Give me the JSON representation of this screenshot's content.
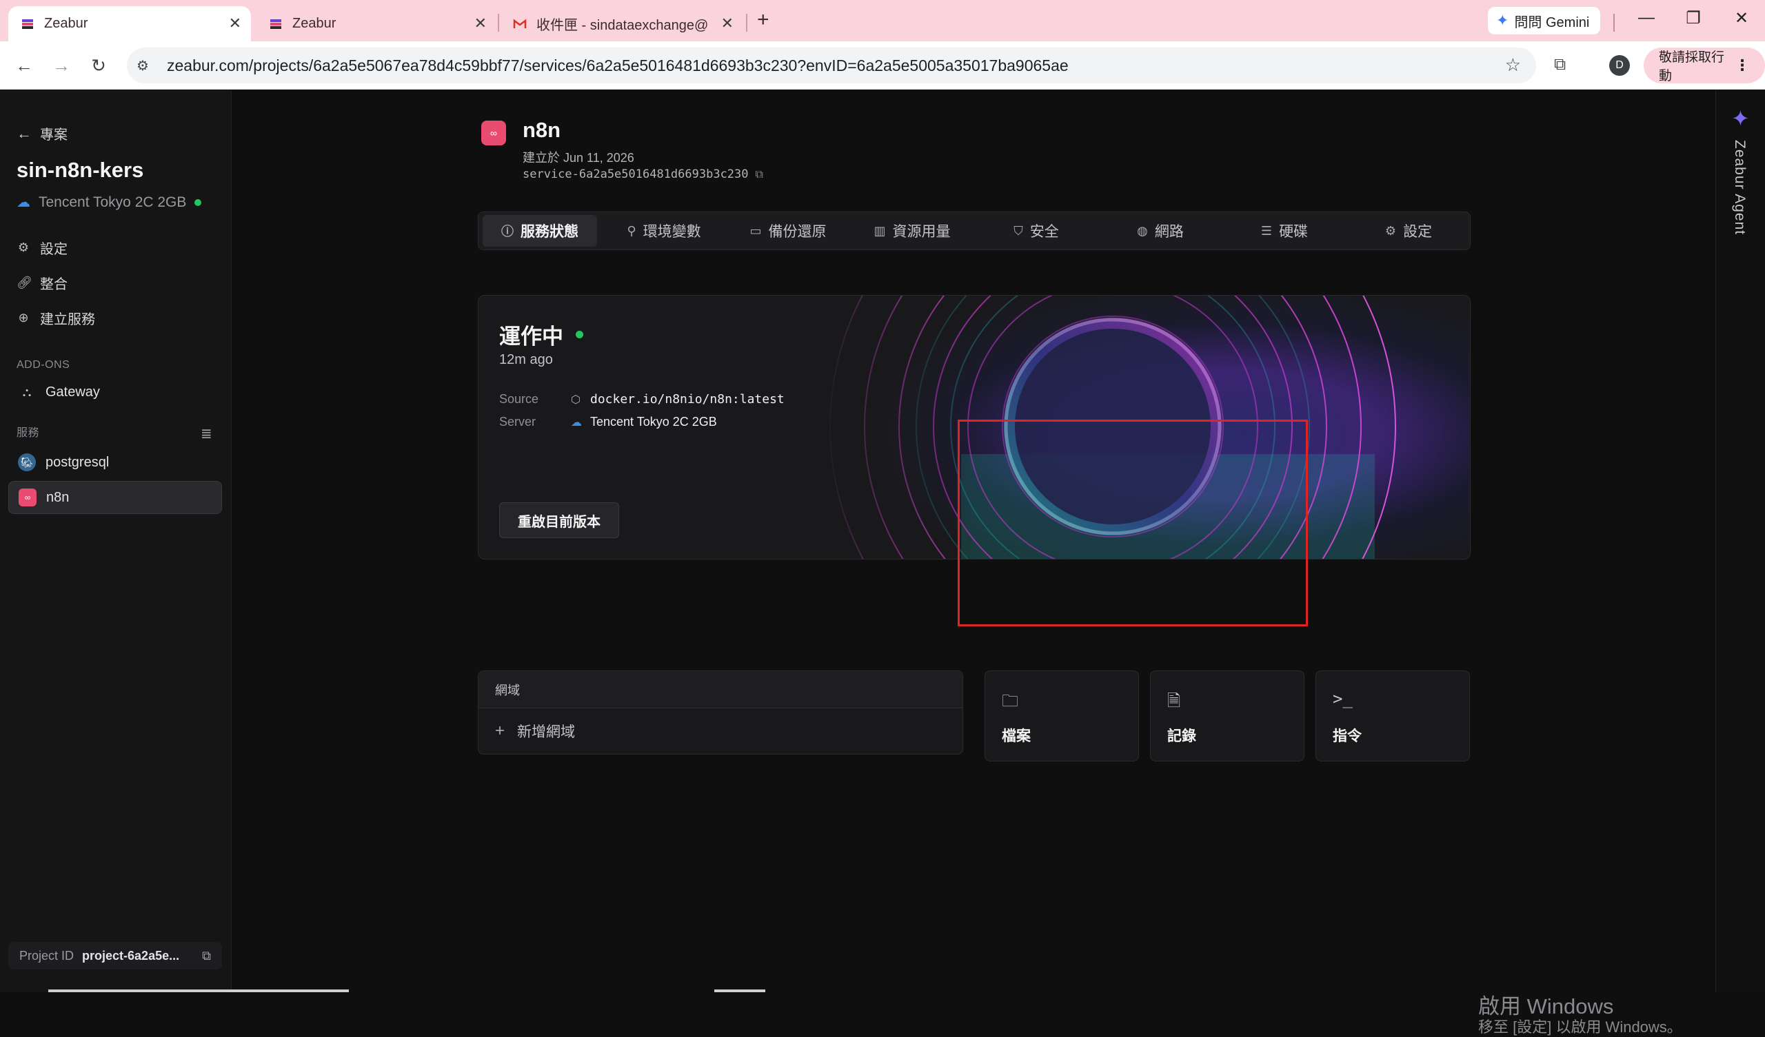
{
  "browser": {
    "tabs": [
      {
        "title": "Zeabur",
        "active": true
      },
      {
        "title": "Zeabur",
        "active": false
      },
      {
        "title": "收件匣 - sindataexchange@gr",
        "active": false
      }
    ],
    "gemini_label": "問問 Gemini",
    "url": "zeabur.com/projects/6a2a5e5067ea78d4c59bbf77/services/6a2a5e5016481d6693b3c230?envID=6a2a5e5005a35017ba9065ae",
    "profile_initial": "D",
    "action_label": "敬請採取行動"
  },
  "sidebar": {
    "back_label": "專案",
    "project_name": "sin-n8n-kers",
    "server_name": "Tencent Tokyo 2C 2GB",
    "links": [
      {
        "label": "設定",
        "icon": "gear-icon"
      },
      {
        "label": "整合",
        "icon": "link-icon"
      },
      {
        "label": "建立服務",
        "icon": "plus-circle-icon"
      }
    ],
    "addons_heading": "ADD-ONS",
    "addons": [
      {
        "label": "Gateway",
        "icon": "gateway-icon"
      }
    ],
    "services_heading": "服務",
    "services": [
      {
        "label": "postgresql",
        "icon": "postgresql-icon",
        "active": false
      },
      {
        "label": "n8n",
        "icon": "n8n-icon",
        "active": true
      }
    ],
    "project_id_label": "Project ID",
    "project_id_value": "project-6a2a5e..."
  },
  "rail": {
    "label": "Zeabur Agent"
  },
  "service": {
    "name": "n8n",
    "created": "建立於 Jun 11, 2026",
    "service_id": "service-6a2a5e5016481d6693b3c230"
  },
  "tabs": [
    {
      "label": "服務狀態",
      "icon": "info-icon",
      "active": true
    },
    {
      "label": "環境變數",
      "icon": "key-icon",
      "active": false
    },
    {
      "label": "備份還原",
      "icon": "archive-icon",
      "active": false
    },
    {
      "label": "資源用量",
      "icon": "bar-chart-icon",
      "active": false
    },
    {
      "label": "安全",
      "icon": "shield-icon",
      "active": false
    },
    {
      "label": "網路",
      "icon": "globe-icon",
      "active": false
    },
    {
      "label": "硬碟",
      "icon": "disk-icon",
      "active": false
    },
    {
      "label": "設定",
      "icon": "gear-icon",
      "active": false
    }
  ],
  "status": {
    "title": "運作中",
    "ago": "12m ago",
    "source_label": "Source",
    "source_value": "docker.io/n8nio/n8n:latest",
    "server_label": "Server",
    "server_value": "Tencent Tokyo 2C 2GB",
    "restart_label": "重啟目前版本"
  },
  "domains": {
    "heading": "網域",
    "add_label": "新增網域"
  },
  "quick_cards": [
    {
      "label": "檔案",
      "icon": "folder-icon"
    },
    {
      "label": "記錄",
      "icon": "document-icon"
    },
    {
      "label": "指令",
      "icon": "terminal-icon"
    }
  ],
  "watermark": {
    "line1": "啟用 Windows",
    "line2": "移至 [設定] 以啟用 Windows。"
  },
  "colors": {
    "accent_n8n": "#ea4b71",
    "status_green": "#22c55e",
    "highlight_red": "#e02424"
  }
}
